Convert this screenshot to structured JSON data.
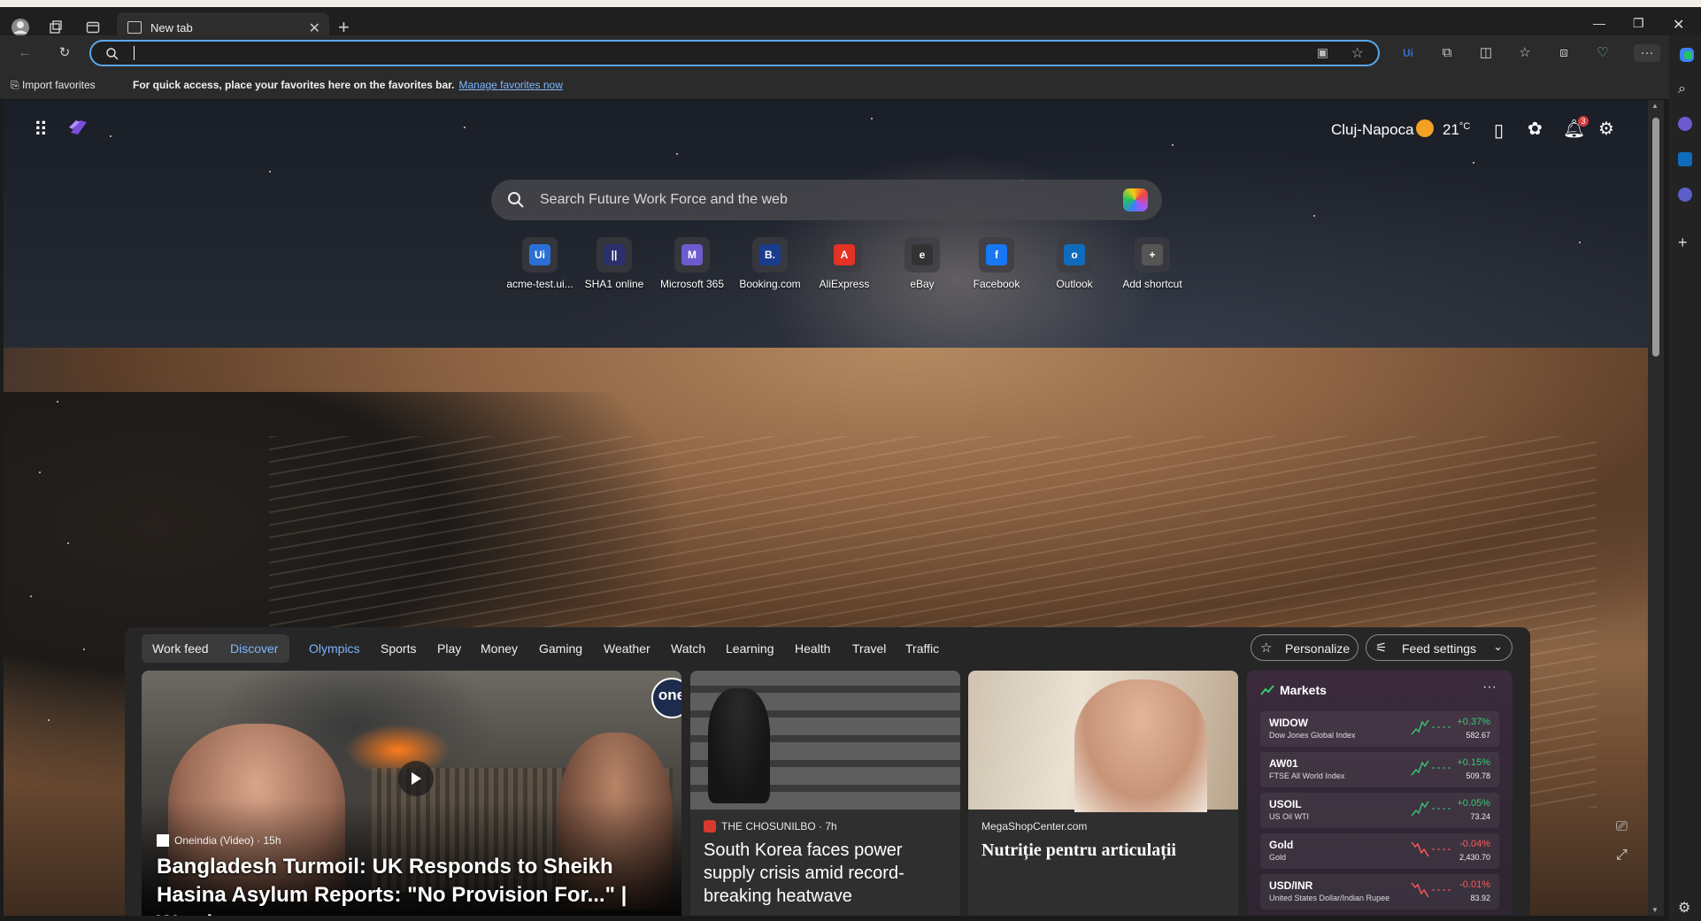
{
  "browser": {
    "tab_title": "New tab",
    "address_value": "",
    "favorites_bar": {
      "import_label": "Import favorites",
      "message": "For quick access, place your favorites here on the favorites bar.",
      "manage_link": "Manage favorites now"
    }
  },
  "ntp": {
    "weather": {
      "city": "Cluj-Napoca",
      "temperature": "21",
      "unit": "°C"
    },
    "notification_count": "3",
    "search_placeholder": "Search Future Work Force and the web",
    "shortcuts": [
      {
        "label": "acme-test.ui...",
        "icon": "uipath-icon",
        "color": "#2a6fd6",
        "glyph": "Ui"
      },
      {
        "label": "SHA1 online",
        "icon": "sha1-icon",
        "color": "#2b2f6b",
        "glyph": "||"
      },
      {
        "label": "Microsoft 365",
        "icon": "microsoft-365-icon",
        "color": "#6d5bd0",
        "glyph": "M"
      },
      {
        "label": "Booking.com",
        "icon": "booking-icon",
        "color": "#1a3c8f",
        "glyph": "B."
      },
      {
        "label": "AliExpress",
        "icon": "aliexpress-icon",
        "color": "#e43225",
        "glyph": "A"
      },
      {
        "label": "eBay",
        "icon": "ebay-bag-icon",
        "color": "#333333",
        "glyph": "e"
      },
      {
        "label": "Facebook",
        "icon": "facebook-icon",
        "color": "#1877f2",
        "glyph": "f"
      },
      {
        "label": "Outlook",
        "icon": "outlook-icon",
        "color": "#0f6cbd",
        "glyph": "o"
      },
      {
        "label": "Add shortcut",
        "icon": "plus-icon",
        "color": "#555555",
        "glyph": "+"
      }
    ]
  },
  "feed": {
    "nav": [
      "Work feed",
      "Discover",
      "Olympics",
      "Sports",
      "Play",
      "Money",
      "Gaming",
      "Weather",
      "Watch",
      "Learning",
      "Health",
      "Travel",
      "Traffic"
    ],
    "personalize_label": "Personalize",
    "feed_settings_label": "Feed settings",
    "hero": {
      "source": "Oneindia (Video) · 15h",
      "badge": "one",
      "title": "Bangladesh Turmoil: UK Responds to Sheikh Hasina Asylum Reports: \"No Provision For...\" | Watch"
    },
    "card2": {
      "source": "THE CHOSUNILBO · 7h",
      "title": "South Korea faces power supply crisis amid record-breaking heatwave"
    },
    "card3": {
      "source": "MegaShopCenter.com",
      "title": "Nutriție pentru articulații"
    },
    "markets": {
      "title": "Markets",
      "rows": [
        {
          "symbol": "WIDOW",
          "name": "Dow Jones Global Index",
          "change": "+0.37%",
          "value": "582.67",
          "color": "#37c871"
        },
        {
          "symbol": "AW01",
          "name": "FTSE All World Index",
          "change": "+0.15%",
          "value": "509.78",
          "color": "#37c871"
        },
        {
          "symbol": "USOIL",
          "name": "US Oil WTI",
          "change": "+0.05%",
          "value": "73.24",
          "color": "#37c871"
        },
        {
          "symbol": "Gold",
          "name": "Gold",
          "change": "-0.04%",
          "value": "2,430.70",
          "color": "#ff5a5a"
        },
        {
          "symbol": "USD/INR",
          "name": "United States Dollar/Indian Rupee",
          "change": "-0.01%",
          "value": "83.92",
          "color": "#ff5a5a"
        }
      ]
    }
  }
}
